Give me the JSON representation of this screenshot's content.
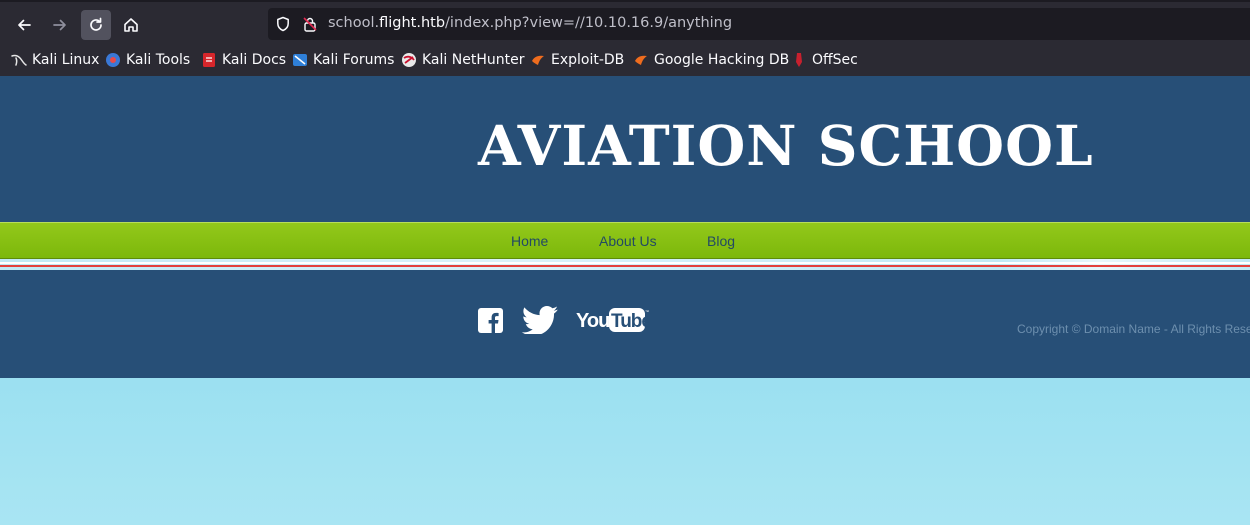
{
  "browser": {
    "url": {
      "prefix": "school.",
      "host": "flight.htb",
      "path": "/index.php?view=//10.10.16.9/anything"
    },
    "bookmarks": [
      {
        "label": "Kali Linux",
        "icon": "kali-dragon-icon"
      },
      {
        "label": "Kali Tools",
        "icon": "kali-tools-icon"
      },
      {
        "label": "Kali Docs",
        "icon": "kali-docs-icon"
      },
      {
        "label": "Kali Forums",
        "icon": "kali-forums-icon"
      },
      {
        "label": "Kali NetHunter",
        "icon": "kali-nethunter-icon"
      },
      {
        "label": "Exploit-DB",
        "icon": "exploit-db-icon"
      },
      {
        "label": "Google Hacking DB",
        "icon": "ghdb-icon"
      },
      {
        "label": "OffSec",
        "icon": "offsec-icon"
      }
    ]
  },
  "site": {
    "title": "AVIATION SCHOOL",
    "menu": [
      {
        "label": "Home"
      },
      {
        "label": "About Us"
      },
      {
        "label": "Blog"
      }
    ],
    "footer": {
      "social": [
        {
          "icon": "facebook-icon"
        },
        {
          "icon": "twitter-icon"
        },
        {
          "icon": "youtube-icon"
        }
      ],
      "copyright": "Copyright © Domain Name - All Rights Rese"
    }
  },
  "colors": {
    "header_bg": "#274f77",
    "menu_green": "#7cb80b",
    "sky_blue": "#7fd6ec",
    "chrome_bg": "#2b2a33"
  }
}
